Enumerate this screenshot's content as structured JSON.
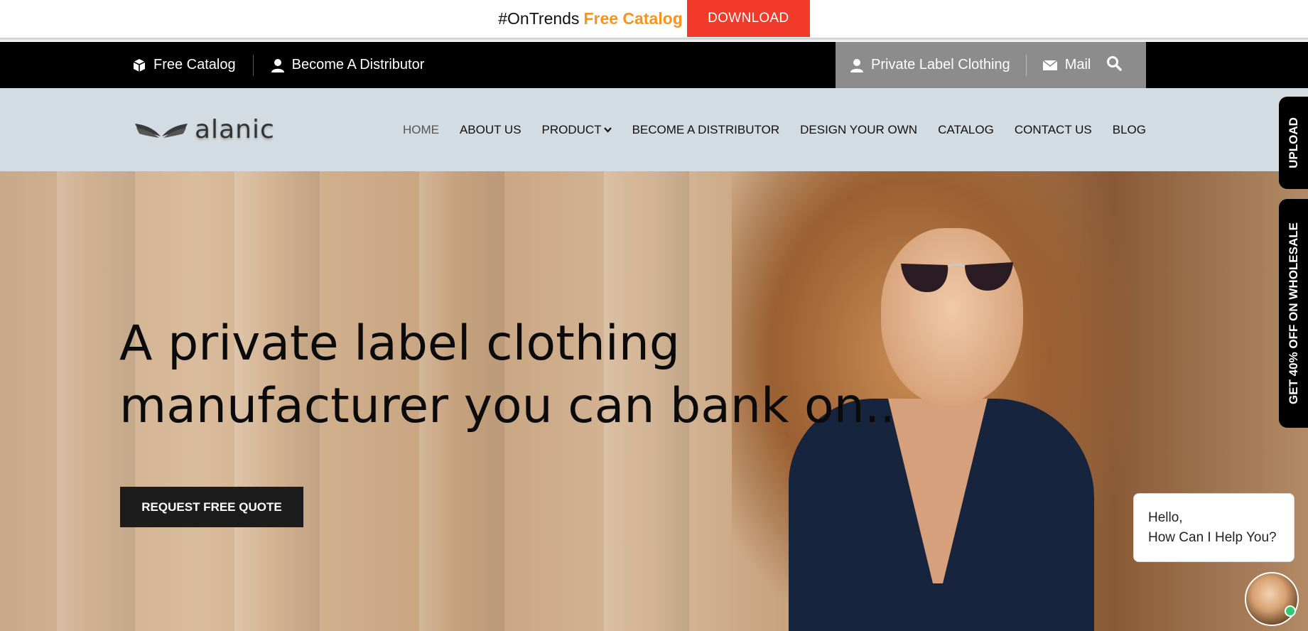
{
  "announce": {
    "tag": "#OnTrends",
    "highlight": "Free Catalog",
    "download": "DOWNLOAD"
  },
  "topbar": {
    "left": [
      {
        "icon": "cube-icon",
        "label": "Free Catalog"
      },
      {
        "icon": "user-icon",
        "label": "Become A Distributor"
      }
    ],
    "right": [
      {
        "icon": "user-icon",
        "label": "Private Label Clothing"
      },
      {
        "icon": "envelope-icon",
        "label": "Mail"
      }
    ],
    "search_icon": "search-icon"
  },
  "nav": {
    "logo_text": "alanic",
    "items": [
      {
        "label": "HOME",
        "active": true
      },
      {
        "label": "ABOUT US"
      },
      {
        "label": "PRODUCT"
      },
      {
        "label": "BECOME A DISTRIBUTOR"
      },
      {
        "label": "DESIGN YOUR OWN"
      },
      {
        "label": "CATALOG"
      },
      {
        "label": "CONTACT US"
      },
      {
        "label": "BLOG"
      }
    ]
  },
  "hero": {
    "line1": "A private label clothing",
    "line2": "manufacturer you can bank on..",
    "cta": "REQUEST FREE QUOTE"
  },
  "side_tabs": {
    "upload": "UPLOAD",
    "wholesale": "GET 40% OFF ON WHOLESALE"
  },
  "chat": {
    "line1": "Hello,",
    "line2": "How Can I Help You?"
  },
  "colors": {
    "accent_orange": "#f7941d",
    "download_red": "#f23a2b",
    "nav_bg": "#d2dce2",
    "topbar_bg": "#000000"
  }
}
